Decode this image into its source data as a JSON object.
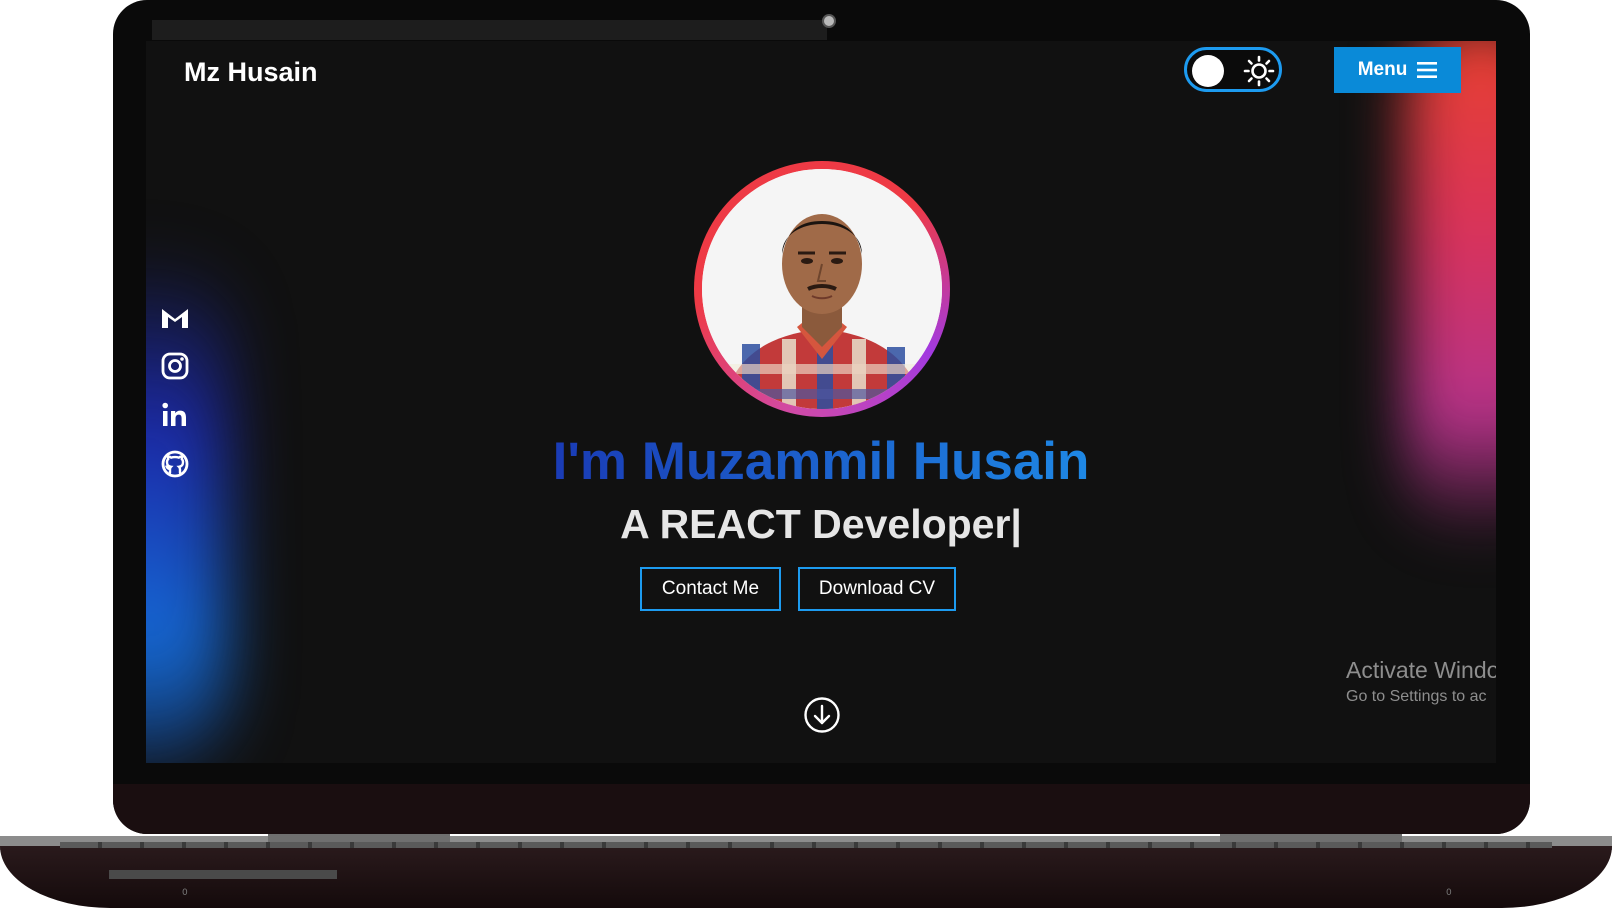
{
  "header": {
    "logo": "Mz Husain",
    "menu_label": "Menu"
  },
  "social": [
    "gmail-icon",
    "instagram-icon",
    "linkedin-icon",
    "github-icon"
  ],
  "hero": {
    "name": "I'm Muzammil Husain",
    "role": "A REACT Developer|",
    "contact_label": "Contact Me",
    "download_label": "Download CV"
  },
  "watermark": {
    "line1": "Activate Windo",
    "line2": "Go to Settings to ac"
  },
  "colors": {
    "accent": "#1d9bf0",
    "menu_bg": "#0a8ad8",
    "ring_red": "#ee3a45",
    "ring_purple": "#a23ae0"
  },
  "footer_marks": [
    "0",
    "0"
  ]
}
